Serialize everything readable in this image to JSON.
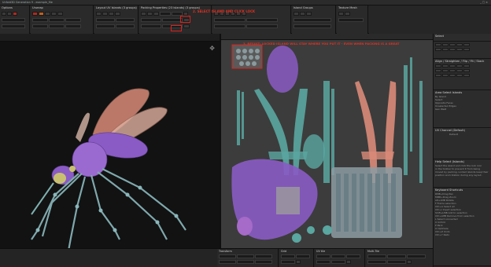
{
  "window": {
    "title": "Unfold3D Generation 9 - example_file",
    "controls": "_ □ ×"
  },
  "toolbar": {
    "groups": [
      {
        "label": "Options"
      },
      {
        "label": "Unwrap"
      },
      {
        "label": "Layout UV Islands (3 groups)"
      },
      {
        "label": "Packing Properties (23 islands) (3 groups)"
      },
      {
        "label": "Island Groups"
      },
      {
        "label": "Texture Mesh"
      }
    ]
  },
  "annotations": {
    "step2": "2. SELECT ISLAND AND CLICK LOCK",
    "step1": "1. CLICK TO ENABLE",
    "step3": "3. RESULT: LOCKED ISLAND WILL STAY WHERE YOU PUT IT - EVEN WHEN PACKING IS A GREAT"
  },
  "right_panel": {
    "title": "Select",
    "sections": [
      {
        "heading": "Align / Straighten / Flip / Fit / Stack"
      },
      {
        "heading": "Area Select Islands",
        "lines": [
          "By Island",
          "Select",
          "Opposite Faces",
          "Unselected Edges",
          "Geo Weld"
        ]
      },
      {
        "heading": "UV Channel (Default)",
        "lines": [
          "Default"
        ]
      },
      {
        "heading": "Help Select (Islands)",
        "lines": [
          "Select the island and click the lock icon",
          "in the toolbar to prevent it from being",
          "moved by packing. Locked islands keep their",
          "position and rotation during any layout."
        ]
      },
      {
        "heading": "Keyboard Shortcuts",
        "lines": [
          "RMB+Drag   Pan",
          "MMB+Drag   Zoom",
          "Alt+LMB     Rotate",
          "F               Frame selection",
          "Ctrl+A        Select all",
          "Ctrl+I        Invert selection",
          "Shift+LMB   Add to selection",
          "Ctrl+LMB    Remove from selection",
          "L               Select connected",
          "U               Unfold",
          "P               Pack",
          "O               Optimize",
          "Ctrl+Z        Undo",
          "Ctrl+Y        Redo"
        ]
      }
    ]
  },
  "bottom": {
    "groups": [
      {
        "label": "Transform"
      },
      {
        "label": "Grid"
      },
      {
        "label": "UV tile"
      },
      {
        "label": "Multi-Tile"
      }
    ]
  },
  "colors": {
    "accent_red": "#e0201a",
    "mesh_purple": "#8a5bc4",
    "mesh_teal": "#5aa6a0",
    "mesh_salmon": "#d98a78",
    "uv_background": "#3c3c3c"
  },
  "icons": [
    "lock-icon",
    "grid-icon",
    "tile-icon",
    "zoom-icon",
    "move-icon"
  ]
}
